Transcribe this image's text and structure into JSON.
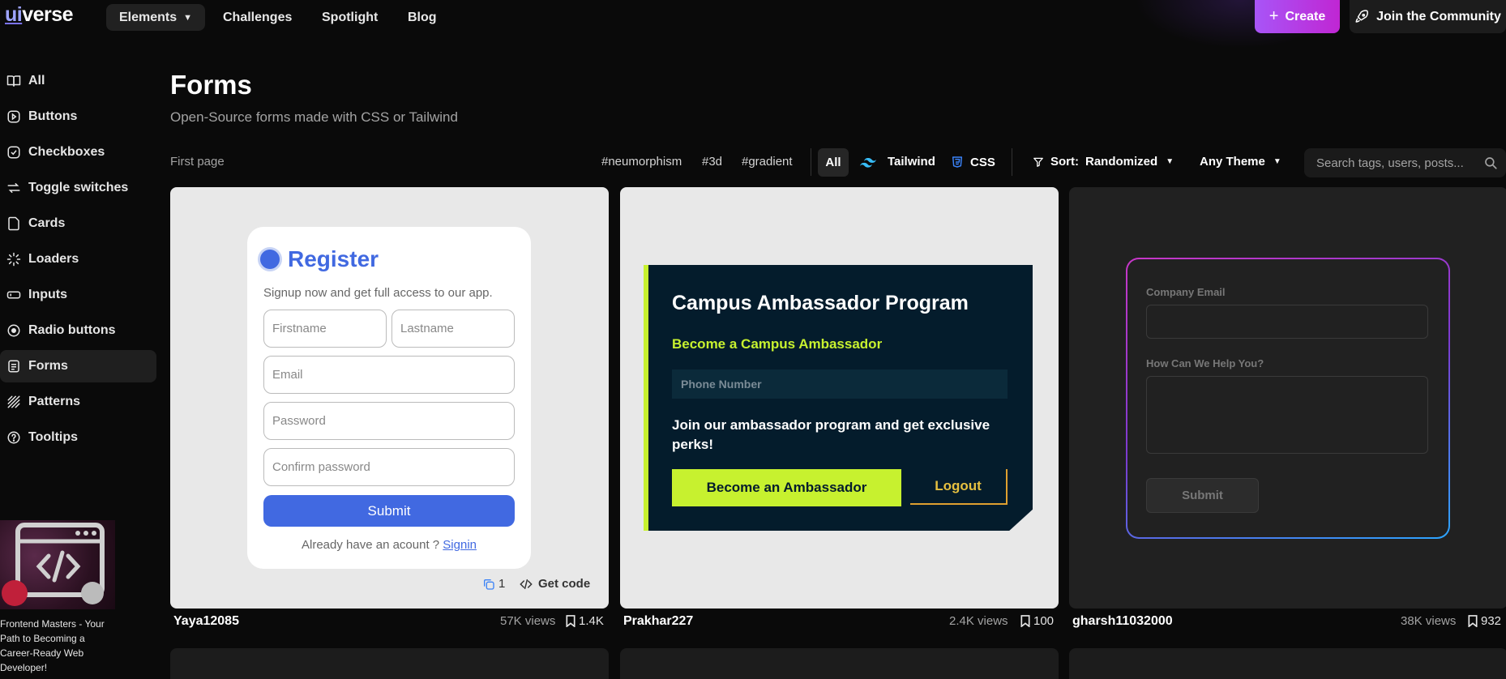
{
  "nav": {
    "logo_ui": "ui",
    "logo_rest": "verse",
    "elements": "Elements",
    "challenges": "Challenges",
    "spotlight": "Spotlight",
    "blog": "Blog",
    "create": "Create",
    "join": "Join the Community"
  },
  "sidebar": {
    "items": [
      {
        "label": "All",
        "icon": "book-icon"
      },
      {
        "label": "Buttons",
        "icon": "button-icon"
      },
      {
        "label": "Checkboxes",
        "icon": "checkbox-icon"
      },
      {
        "label": "Toggle switches",
        "icon": "toggle-icon"
      },
      {
        "label": "Cards",
        "icon": "card-icon"
      },
      {
        "label": "Loaders",
        "icon": "loader-icon"
      },
      {
        "label": "Inputs",
        "icon": "input-icon"
      },
      {
        "label": "Radio buttons",
        "icon": "radio-icon"
      },
      {
        "label": "Forms",
        "icon": "form-icon"
      },
      {
        "label": "Patterns",
        "icon": "pattern-icon"
      },
      {
        "label": "Tooltips",
        "icon": "tooltip-icon"
      }
    ],
    "active": "Forms",
    "ad_text": "Frontend Masters - Your Path to Becoming a Career-Ready Web Developer!"
  },
  "header": {
    "title": "Forms",
    "subtitle": "Open-Source forms made with CSS or Tailwind"
  },
  "filters": {
    "first_page": "First page",
    "tags": [
      "#neumorphism",
      "#3d",
      "#gradient"
    ],
    "all": "All",
    "tailwind": "Tailwind",
    "css": "CSS",
    "sort_label": "Sort:",
    "sort_value": "Randomized",
    "theme": "Any Theme",
    "search_placeholder": "Search tags, users, posts..."
  },
  "cards": [
    {
      "author": "Yaya12085",
      "views": "57K views",
      "saves": "1.4K",
      "likes": "1",
      "get_code": "Get code",
      "form": {
        "title": "Register",
        "subtitle": "Signup now and get full access to our app.",
        "firstname": "Firstname",
        "lastname": "Lastname",
        "email": "Email",
        "password": "Password",
        "confirm": "Confirm password",
        "submit": "Submit",
        "signin_prompt": "Already have an acount ?",
        "signin_link": "Signin"
      }
    },
    {
      "author": "Prakhar227",
      "views": "2.4K views",
      "saves": "100",
      "form": {
        "title": "Campus Ambassador Program",
        "subtitle": "Become a Campus Ambassador",
        "phone": "Phone Number",
        "text": "Join our ambassador program and get exclusive perks!",
        "button": "Become an Ambassador",
        "logout": "Logout"
      }
    },
    {
      "author": "gharsh11032000",
      "views": "38K views",
      "saves": "932",
      "form": {
        "email_label": "Company Email",
        "help_label": "How Can We Help You?",
        "submit": "Submit"
      }
    }
  ],
  "colors": {
    "accent": "#a855f7",
    "register_blue": "#4169e1",
    "ambassador_lime": "#c7f12f",
    "ambassador_navy": "#041c2c"
  }
}
